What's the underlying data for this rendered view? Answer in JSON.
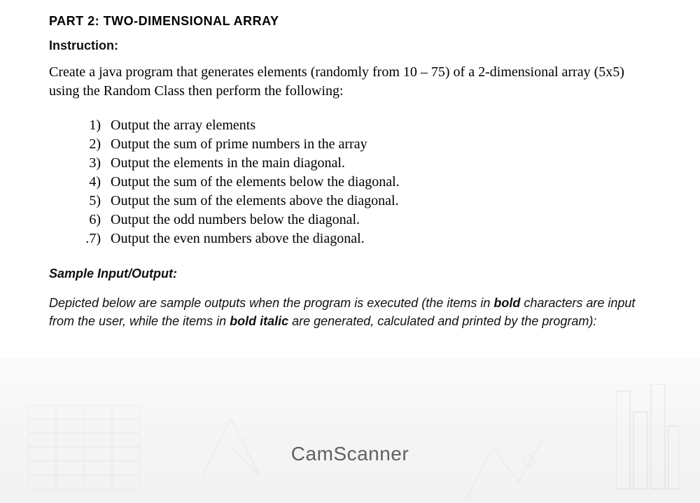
{
  "part_title": "PART 2: TWO-DIMENSIONAL ARRAY",
  "instruction_label": "Instruction:",
  "body_text": "Create a java program that generates elements (randomly from 10 – 75) of a 2-dimensional array (5x5) using the Random Class then perform the following:",
  "list": {
    "items": [
      {
        "num": "1)",
        "text": "Output the array elements"
      },
      {
        "num": "2)",
        "text": "Output the sum of prime numbers in the array"
      },
      {
        "num": "3)",
        "text": "Output the elements in the main diagonal."
      },
      {
        "num": "4)",
        "text": "Output the sum of the elements below the diagonal."
      },
      {
        "num": "5)",
        "text": "Output the sum of the elements above the diagonal."
      },
      {
        "num": "6)",
        "text": "Output the odd numbers below the diagonal."
      },
      {
        "num": ".7)",
        "text": "Output the even numbers above the diagonal."
      }
    ]
  },
  "sample_label": "Sample Input/Output:",
  "depicted": {
    "pre": "Depicted below are sample outputs when the program is executed (the items in ",
    "bold1": "bold",
    "mid1": " characters are input from the user, while the items in ",
    "bold_italic": "bold italic",
    "mid2": " are generated, calculated and printed by the program):"
  },
  "watermark": "CamScanner"
}
